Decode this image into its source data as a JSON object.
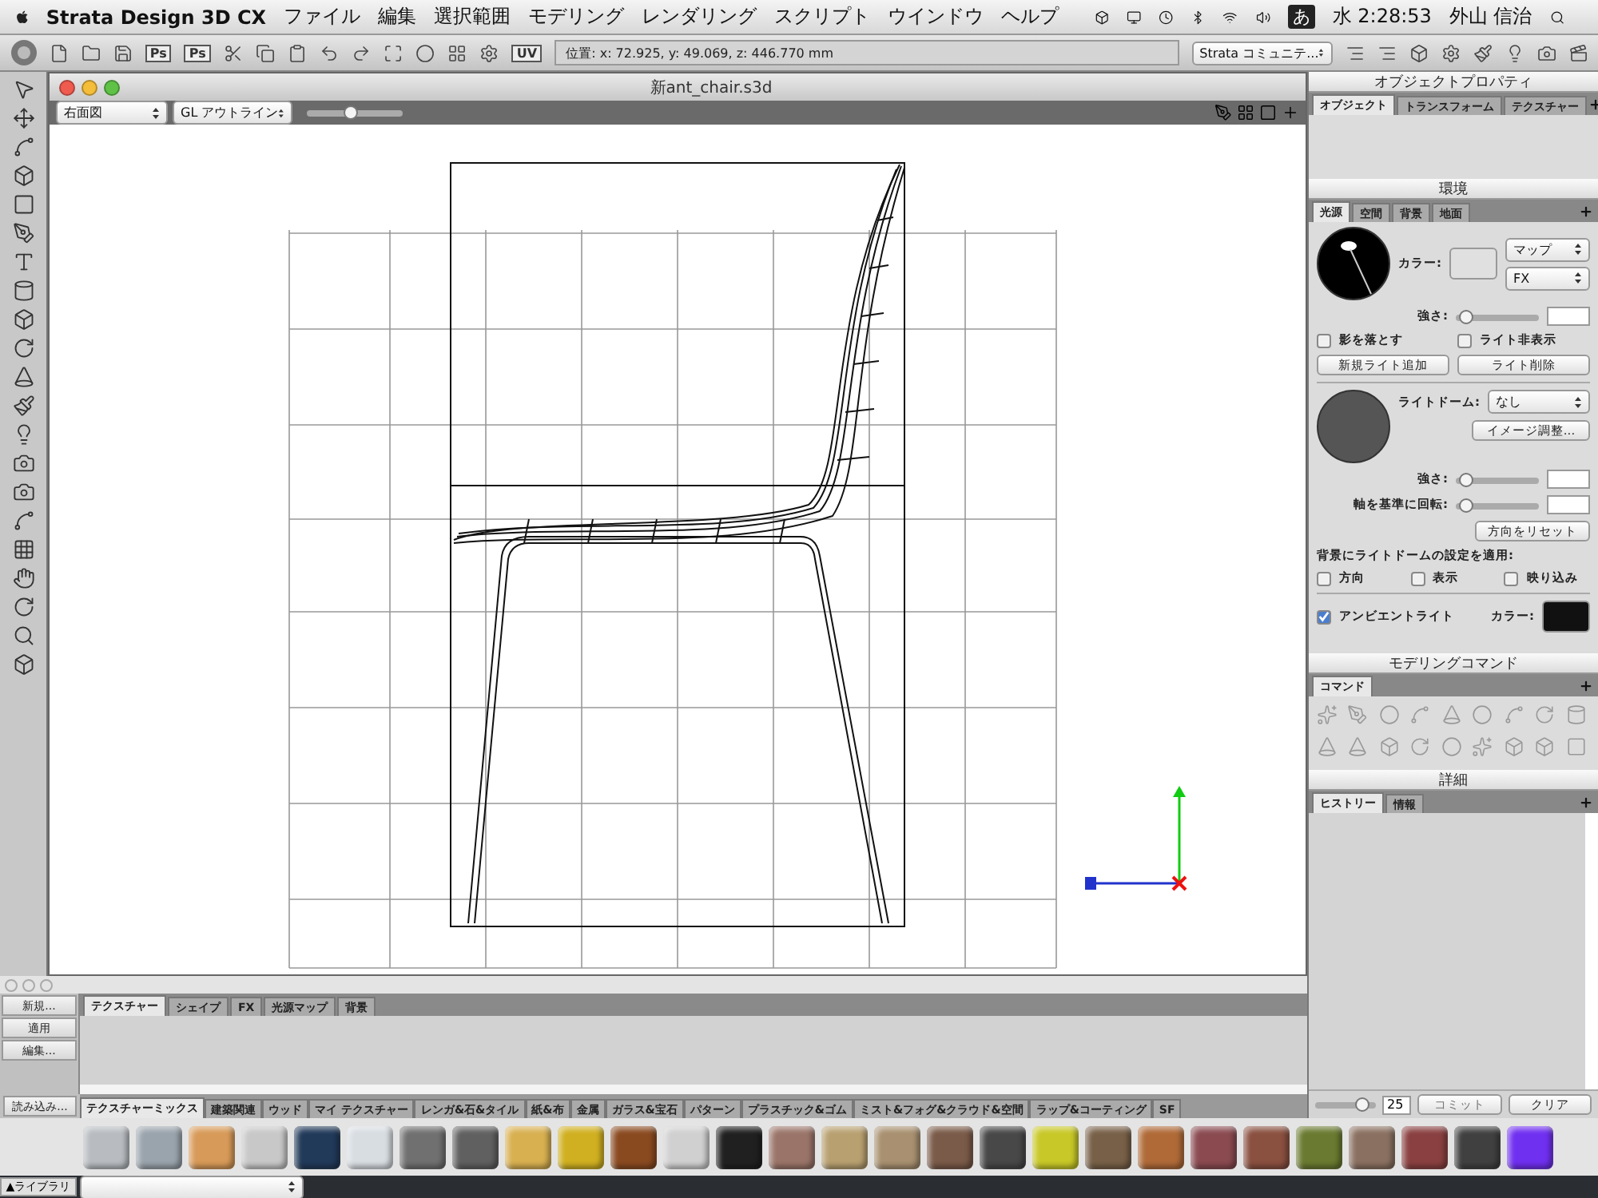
{
  "menubar": {
    "app": "Strata Design 3D CX",
    "menus": [
      "ファイル",
      "編集",
      "選択範囲",
      "モデリング",
      "レンダリング",
      "スクリプト",
      "ウインドウ",
      "ヘルプ"
    ],
    "input_method": "あ",
    "clock": "水 2:28:53",
    "user": "外山 信治"
  },
  "toolbar": {
    "ps_buttons": [
      "Ps",
      "Ps"
    ],
    "uv_button": "UV",
    "position": "位置: x: 72.925, y: 49.069, z: 446.770 mm",
    "community": "Strata コミュニテ..."
  },
  "document": {
    "title": "新ant_chair.s3d",
    "view": "右面図",
    "render_mode": "GL アウトライン",
    "zoom": {
      "level": 0.45
    }
  },
  "object_properties": {
    "title": "オブジェクトプロパティ",
    "tabs": [
      {
        "label": "オブジェクト",
        "selected": true
      },
      {
        "label": "トランスフォーム",
        "selected": false
      },
      {
        "label": "テクスチャー",
        "selected": false
      }
    ]
  },
  "environment": {
    "title": "環境",
    "tabs": [
      {
        "label": "光源",
        "selected": true
      },
      {
        "label": "空間",
        "selected": false
      },
      {
        "label": "背景",
        "selected": false
      },
      {
        "label": "地面",
        "selected": false
      }
    ],
    "color_label": "カラー:",
    "map_select": "マップ",
    "fx_select": "FX",
    "intensity_label": "強さ:",
    "intensity": {
      "level": 0.05
    },
    "checkboxes": [
      {
        "label": "影を落とす",
        "checked": false
      },
      {
        "label": "ライト非表示",
        "checked": false
      }
    ],
    "buttons": [
      "新規ライト追加",
      "ライト削除"
    ],
    "light_dome_label": "ライトドーム:",
    "light_dome_select": "なし",
    "image_adjust": "イメージ調整...",
    "dome_intensity_label": "強さ:",
    "dome_intensity": {
      "level": 0.05
    },
    "rotate_label": "軸を基準に回転:",
    "rotate": {
      "level": 0.05
    },
    "reset_button": "方向をリセット",
    "apply_label": "背景にライトドームの設定を適用:",
    "apply_checkboxes": [
      {
        "label": "方向",
        "checked": false
      },
      {
        "label": "表示",
        "checked": false
      },
      {
        "label": "映り込み",
        "checked": false
      }
    ],
    "ambient": {
      "label": "アンビエントライト",
      "checked": true
    },
    "ambient_color_label": "カラー:"
  },
  "modeling_commands": {
    "title": "モデリングコマンド",
    "tabs": [
      {
        "label": "コマンド",
        "selected": true
      }
    ]
  },
  "details": {
    "title": "詳細",
    "tabs": [
      {
        "label": "ヒストリー",
        "selected": true
      },
      {
        "label": "情報",
        "selected": false
      }
    ],
    "history": {
      "level": 0.75
    },
    "history_count": "25",
    "commit": "コミット",
    "clear": "クリア"
  },
  "resource_panel": {
    "side_buttons": [
      "新規...",
      "適用",
      "編集..."
    ],
    "load_button": "読み込み...",
    "tabs": [
      {
        "label": "テクスチャー",
        "selected": true
      },
      {
        "label": "シェイプ",
        "selected": false
      },
      {
        "label": "FX",
        "selected": false
      },
      {
        "label": "光源マップ",
        "selected": false
      },
      {
        "label": "背景",
        "selected": false
      }
    ],
    "library_tabs": [
      {
        "label": "テクスチャーミックス",
        "selected": true
      },
      {
        "label": "建築関連",
        "selected": false
      },
      {
        "label": "ウッド",
        "selected": false
      },
      {
        "label": "マイ テクスチャー",
        "selected": false
      },
      {
        "label": "レンガ&石&タイル",
        "selected": false
      },
      {
        "label": "紙&布",
        "selected": false
      },
      {
        "label": "金属",
        "selected": false
      },
      {
        "label": "ガラス&宝石",
        "selected": false
      },
      {
        "label": "パターン",
        "selected": false
      },
      {
        "label": "プラスチック&ゴム",
        "selected": false
      },
      {
        "label": "ミスト&フォグ&クラウド&空間",
        "selected": false
      },
      {
        "label": "ラップ&コーティング",
        "selected": false
      },
      {
        "label": "SF",
        "selected": false
      }
    ],
    "library_toggle": "▲ライブラリ",
    "swatches": [
      {
        "color": "#b8bcc0"
      },
      {
        "color": "#9aa4ac"
      },
      {
        "color": "#d89a58"
      },
      {
        "color": "#c8c8c8"
      },
      {
        "color": "#223a5a"
      },
      {
        "color": "#d8dde2"
      },
      {
        "color": "#707070"
      },
      {
        "color": "#606060"
      },
      {
        "color": "#d8b050"
      },
      {
        "color": "#d0b020"
      },
      {
        "color": "#8a4a20"
      },
      {
        "color": "#d0d0d0"
      },
      {
        "color": "#202020"
      },
      {
        "color": "#9a7468"
      },
      {
        "color": "#b8a070"
      },
      {
        "color": "#a89070"
      },
      {
        "color": "#7a5a48"
      },
      {
        "color": "#484848"
      },
      {
        "color": "#c8c828"
      },
      {
        "color": "#786048"
      },
      {
        "color": "#b06a38"
      },
      {
        "color": "#8a4a50"
      },
      {
        "color": "#8a5040"
      },
      {
        "color": "#6a7a30"
      },
      {
        "color": "#8a7060"
      },
      {
        "color": "#8a4040"
      },
      {
        "color": "#404040"
      },
      {
        "color": "#7030f0"
      }
    ]
  }
}
